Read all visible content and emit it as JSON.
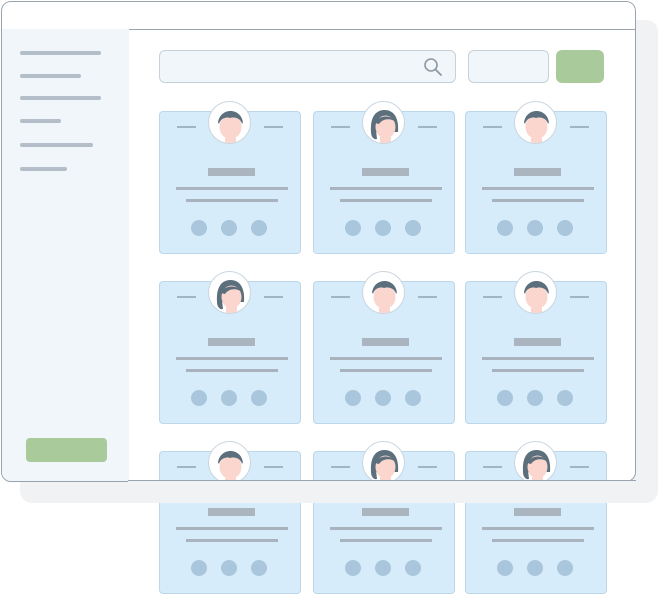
{
  "app": {
    "window_title": "",
    "search": {
      "placeholder": "",
      "value": "",
      "icon": "search-icon"
    },
    "filter": {
      "label": ""
    },
    "primary_button": {
      "label": ""
    }
  },
  "sidebar": {
    "items": [
      {
        "label": ""
      },
      {
        "label": ""
      },
      {
        "label": ""
      },
      {
        "label": ""
      },
      {
        "label": ""
      },
      {
        "label": ""
      }
    ],
    "footer_button": {
      "label": ""
    }
  },
  "cards": [
    {
      "name": "",
      "avatar": "female-avatar-icon"
    },
    {
      "name": "",
      "avatar": "female-long-hair-avatar-icon"
    },
    {
      "name": "",
      "avatar": "female-avatar-icon"
    },
    {
      "name": "",
      "avatar": "female-long-hair-avatar-icon"
    },
    {
      "name": "",
      "avatar": "female-avatar-icon"
    },
    {
      "name": "",
      "avatar": "female-avatar-icon"
    },
    {
      "name": "",
      "avatar": "female-avatar-icon"
    },
    {
      "name": "",
      "avatar": "female-long-hair-avatar-icon"
    },
    {
      "name": "",
      "avatar": "female-long-hair-avatar-icon"
    }
  ],
  "colors": {
    "accent_green": "#a9cb9b",
    "card_blue": "#d6ecfa",
    "sidebar_bg": "#f1f6fa",
    "border": "#98a3ad"
  }
}
